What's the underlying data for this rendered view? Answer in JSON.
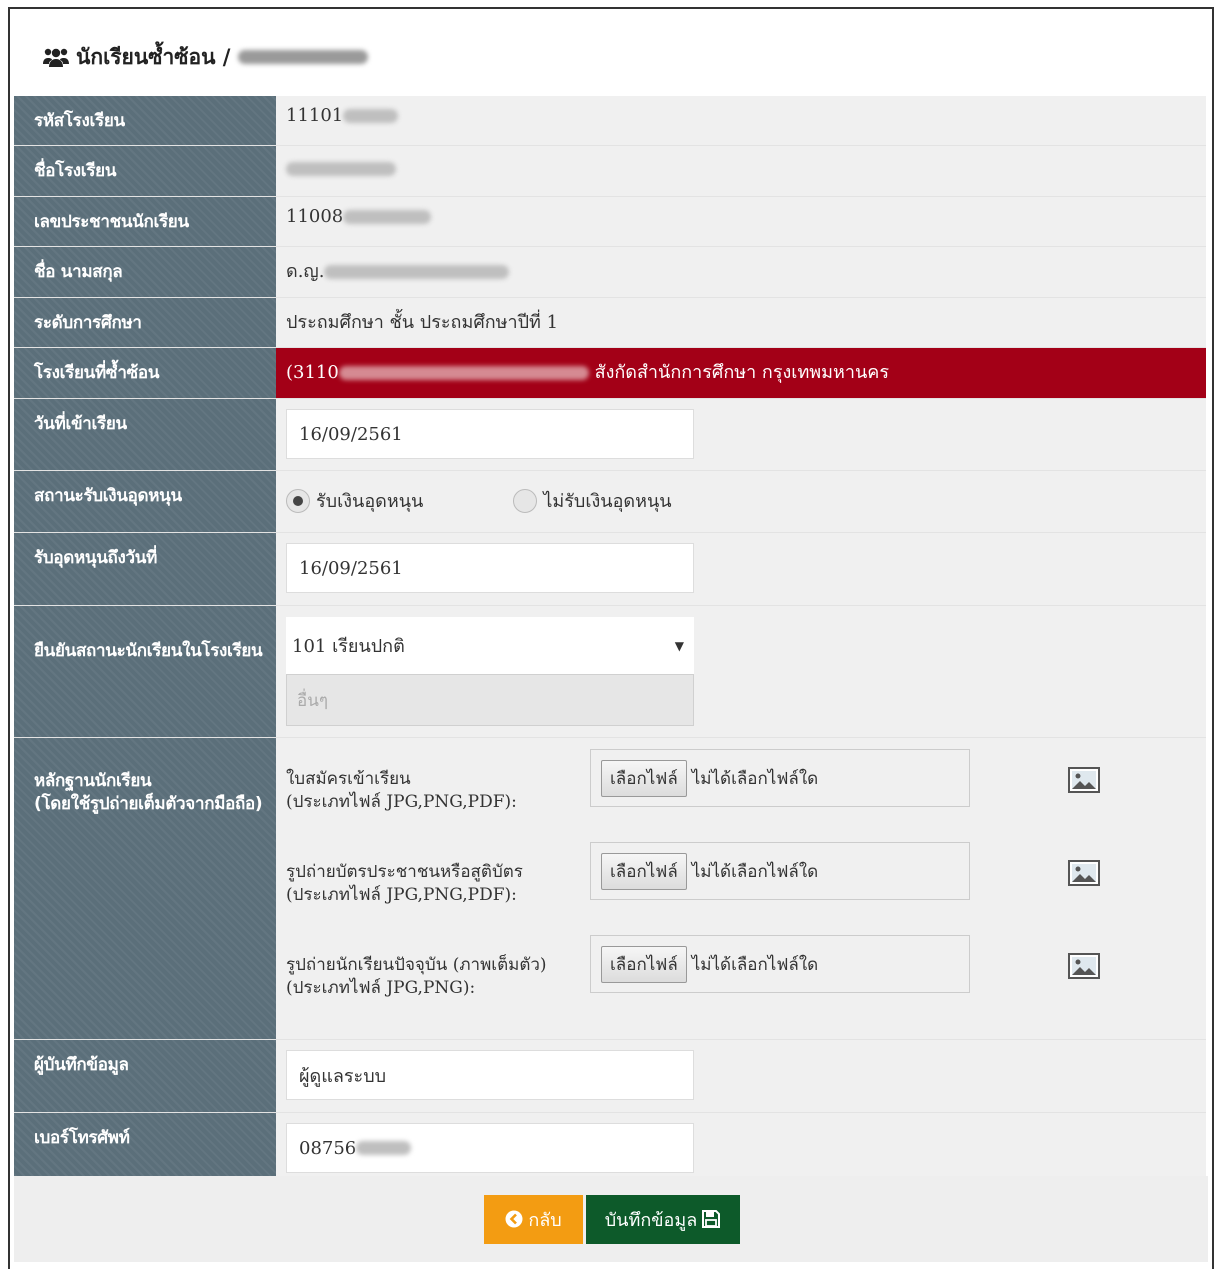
{
  "header": {
    "title": "นักเรียนซ้ำซ้อน /"
  },
  "fields": {
    "school_code": {
      "label": "รหัสโรงเรียน",
      "value": "11101"
    },
    "school_name": {
      "label": "ชื่อโรงเรียน",
      "value": ""
    },
    "citizen_id": {
      "label": "เลขประชาชนนักเรียน",
      "value": "11008"
    },
    "full_name": {
      "label": "ชื่อ นามสกุล",
      "value": "ด.ญ."
    },
    "level": {
      "label": "ระดับการศึกษา",
      "value": "ประถมศึกษา  ชั้น ประถมศึกษาปีที่ 1"
    },
    "duplicate_school": {
      "label": "โรงเรียนที่ซ้ำซ้อน",
      "prefix": "(3110",
      "suffix": "สังกัดสำนักการศึกษา กรุงเทพมหานคร"
    },
    "enroll_date": {
      "label": "วันที่เข้าเรียน",
      "value": "16/09/2561"
    },
    "subsidy_status": {
      "label": "สถานะรับเงินอุดหนุน",
      "option_yes": "รับเงินอุดหนุน",
      "option_no": "ไม่รับเงินอุดหนุน"
    },
    "subsidy_date": {
      "label": "รับอุดหนุนถึงวันที่",
      "value": "16/09/2561"
    },
    "confirm_status": {
      "label": "ยืนยันสถานะนักเรียนในโรงเรียน",
      "selected": "101 เรียนปกติ",
      "other_placeholder": "อื่นๆ"
    },
    "evidence": {
      "label_line1": "หลักฐานนักเรียน",
      "label_line2": "(โดยใช้รูปถ่ายเต็มตัวจากมือถือ)",
      "files": [
        {
          "line1": "ใบสมัครเข้าเรียน",
          "line2": "(ประเภทไฟล์ JPG,PNG,PDF):",
          "button": "เลือกไฟล์",
          "status": "ไม่ได้เลือกไฟล์ใด"
        },
        {
          "line1": "รูปถ่ายบัตรประชาชนหรือสูติบัตร",
          "line2": "(ประเภทไฟล์ JPG,PNG,PDF):",
          "button": "เลือกไฟล์",
          "status": "ไม่ได้เลือกไฟล์ใด"
        },
        {
          "line1": "รูปถ่ายนักเรียนปัจจุบัน (ภาพเต็มตัว)",
          "line2": "(ประเภทไฟล์ JPG,PNG):",
          "button": "เลือกไฟล์",
          "status": "ไม่ได้เลือกไฟล์ใด"
        }
      ]
    },
    "recorder": {
      "label": "ผู้บันทึกข้อมูล",
      "value": "ผู้ดูแลระบบ"
    },
    "phone": {
      "label": "เบอร์โทรศัพท์",
      "value": "08756"
    }
  },
  "buttons": {
    "back": "กลับ",
    "save": "บันทึกข้อมูล"
  }
}
